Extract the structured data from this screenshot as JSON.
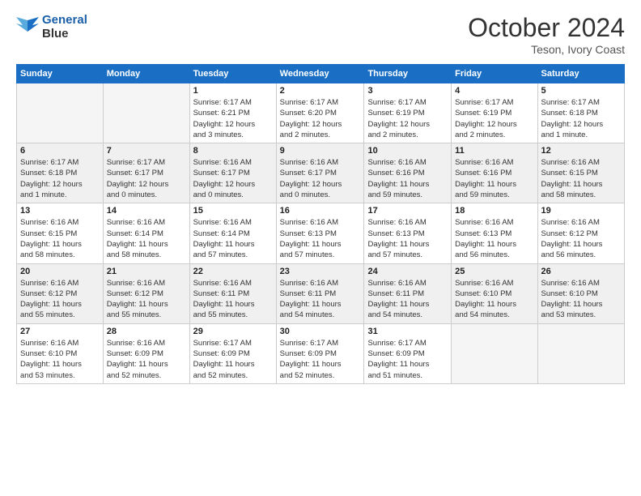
{
  "logo": {
    "line1": "General",
    "line2": "Blue"
  },
  "title": "October 2024",
  "subtitle": "Teson, Ivory Coast",
  "weekdays": [
    "Sunday",
    "Monday",
    "Tuesday",
    "Wednesday",
    "Thursday",
    "Friday",
    "Saturday"
  ],
  "weeks": [
    [
      {
        "day": "",
        "info": ""
      },
      {
        "day": "",
        "info": ""
      },
      {
        "day": "1",
        "info": "Sunrise: 6:17 AM\nSunset: 6:21 PM\nDaylight: 12 hours\nand 3 minutes."
      },
      {
        "day": "2",
        "info": "Sunrise: 6:17 AM\nSunset: 6:20 PM\nDaylight: 12 hours\nand 2 minutes."
      },
      {
        "day": "3",
        "info": "Sunrise: 6:17 AM\nSunset: 6:19 PM\nDaylight: 12 hours\nand 2 minutes."
      },
      {
        "day": "4",
        "info": "Sunrise: 6:17 AM\nSunset: 6:19 PM\nDaylight: 12 hours\nand 2 minutes."
      },
      {
        "day": "5",
        "info": "Sunrise: 6:17 AM\nSunset: 6:18 PM\nDaylight: 12 hours\nand 1 minute."
      }
    ],
    [
      {
        "day": "6",
        "info": "Sunrise: 6:17 AM\nSunset: 6:18 PM\nDaylight: 12 hours\nand 1 minute."
      },
      {
        "day": "7",
        "info": "Sunrise: 6:17 AM\nSunset: 6:17 PM\nDaylight: 12 hours\nand 0 minutes."
      },
      {
        "day": "8",
        "info": "Sunrise: 6:16 AM\nSunset: 6:17 PM\nDaylight: 12 hours\nand 0 minutes."
      },
      {
        "day": "9",
        "info": "Sunrise: 6:16 AM\nSunset: 6:17 PM\nDaylight: 12 hours\nand 0 minutes."
      },
      {
        "day": "10",
        "info": "Sunrise: 6:16 AM\nSunset: 6:16 PM\nDaylight: 11 hours\nand 59 minutes."
      },
      {
        "day": "11",
        "info": "Sunrise: 6:16 AM\nSunset: 6:16 PM\nDaylight: 11 hours\nand 59 minutes."
      },
      {
        "day": "12",
        "info": "Sunrise: 6:16 AM\nSunset: 6:15 PM\nDaylight: 11 hours\nand 58 minutes."
      }
    ],
    [
      {
        "day": "13",
        "info": "Sunrise: 6:16 AM\nSunset: 6:15 PM\nDaylight: 11 hours\nand 58 minutes."
      },
      {
        "day": "14",
        "info": "Sunrise: 6:16 AM\nSunset: 6:14 PM\nDaylight: 11 hours\nand 58 minutes."
      },
      {
        "day": "15",
        "info": "Sunrise: 6:16 AM\nSunset: 6:14 PM\nDaylight: 11 hours\nand 57 minutes."
      },
      {
        "day": "16",
        "info": "Sunrise: 6:16 AM\nSunset: 6:13 PM\nDaylight: 11 hours\nand 57 minutes."
      },
      {
        "day": "17",
        "info": "Sunrise: 6:16 AM\nSunset: 6:13 PM\nDaylight: 11 hours\nand 57 minutes."
      },
      {
        "day": "18",
        "info": "Sunrise: 6:16 AM\nSunset: 6:13 PM\nDaylight: 11 hours\nand 56 minutes."
      },
      {
        "day": "19",
        "info": "Sunrise: 6:16 AM\nSunset: 6:12 PM\nDaylight: 11 hours\nand 56 minutes."
      }
    ],
    [
      {
        "day": "20",
        "info": "Sunrise: 6:16 AM\nSunset: 6:12 PM\nDaylight: 11 hours\nand 55 minutes."
      },
      {
        "day": "21",
        "info": "Sunrise: 6:16 AM\nSunset: 6:12 PM\nDaylight: 11 hours\nand 55 minutes."
      },
      {
        "day": "22",
        "info": "Sunrise: 6:16 AM\nSunset: 6:11 PM\nDaylight: 11 hours\nand 55 minutes."
      },
      {
        "day": "23",
        "info": "Sunrise: 6:16 AM\nSunset: 6:11 PM\nDaylight: 11 hours\nand 54 minutes."
      },
      {
        "day": "24",
        "info": "Sunrise: 6:16 AM\nSunset: 6:11 PM\nDaylight: 11 hours\nand 54 minutes."
      },
      {
        "day": "25",
        "info": "Sunrise: 6:16 AM\nSunset: 6:10 PM\nDaylight: 11 hours\nand 54 minutes."
      },
      {
        "day": "26",
        "info": "Sunrise: 6:16 AM\nSunset: 6:10 PM\nDaylight: 11 hours\nand 53 minutes."
      }
    ],
    [
      {
        "day": "27",
        "info": "Sunrise: 6:16 AM\nSunset: 6:10 PM\nDaylight: 11 hours\nand 53 minutes."
      },
      {
        "day": "28",
        "info": "Sunrise: 6:16 AM\nSunset: 6:09 PM\nDaylight: 11 hours\nand 52 minutes."
      },
      {
        "day": "29",
        "info": "Sunrise: 6:17 AM\nSunset: 6:09 PM\nDaylight: 11 hours\nand 52 minutes."
      },
      {
        "day": "30",
        "info": "Sunrise: 6:17 AM\nSunset: 6:09 PM\nDaylight: 11 hours\nand 52 minutes."
      },
      {
        "day": "31",
        "info": "Sunrise: 6:17 AM\nSunset: 6:09 PM\nDaylight: 11 hours\nand 51 minutes."
      },
      {
        "day": "",
        "info": ""
      },
      {
        "day": "",
        "info": ""
      }
    ]
  ]
}
